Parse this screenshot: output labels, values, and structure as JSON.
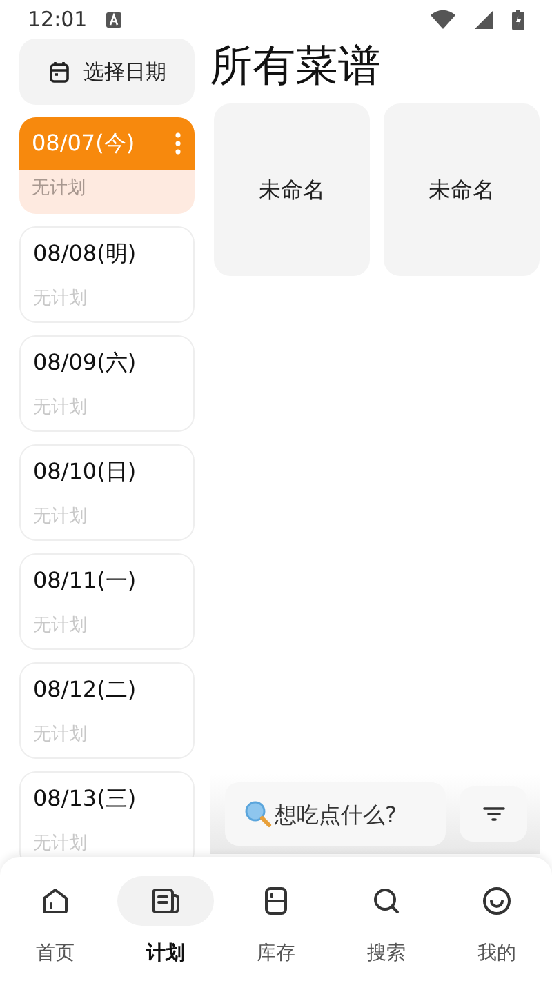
{
  "status_bar": {
    "time": "12:01"
  },
  "date_button": {
    "label": "选择日期"
  },
  "title": "所有菜谱",
  "days": [
    {
      "date": "08/07(今)",
      "plan": "无计划",
      "selected": true
    },
    {
      "date": "08/08(明)",
      "plan": "无计划",
      "selected": false
    },
    {
      "date": "08/09(六)",
      "plan": "无计划",
      "selected": false
    },
    {
      "date": "08/10(日)",
      "plan": "无计划",
      "selected": false
    },
    {
      "date": "08/11(一)",
      "plan": "无计划",
      "selected": false
    },
    {
      "date": "08/12(二)",
      "plan": "无计划",
      "selected": false
    },
    {
      "date": "08/13(三)",
      "plan": "无计划",
      "selected": false
    }
  ],
  "recipes": [
    {
      "name": "未命名"
    },
    {
      "name": "未命名"
    }
  ],
  "search": {
    "placeholder": "想吃点什么?"
  },
  "nav": [
    {
      "label": "首页",
      "kind": "home",
      "selected": false
    },
    {
      "label": "计划",
      "kind": "plan",
      "selected": true
    },
    {
      "label": "库存",
      "kind": "fridge",
      "selected": false
    },
    {
      "label": "搜索",
      "kind": "search",
      "selected": false
    },
    {
      "label": "我的",
      "kind": "me",
      "selected": false
    }
  ]
}
